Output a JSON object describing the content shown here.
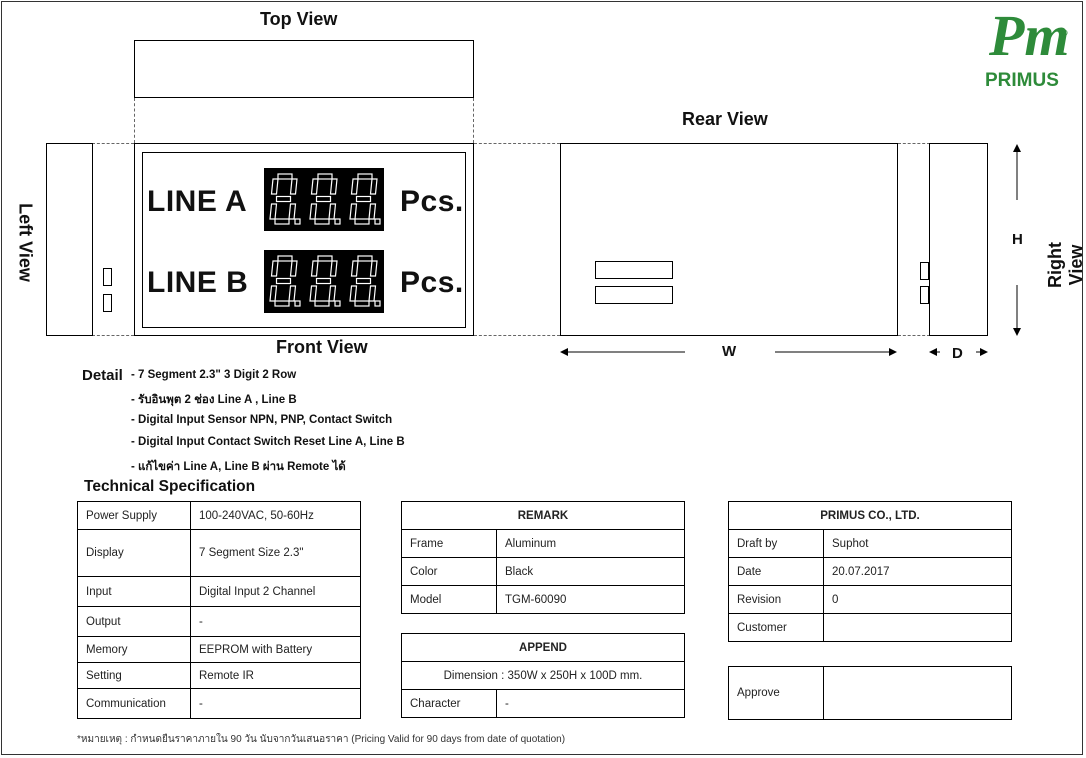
{
  "views": {
    "top": "Top View",
    "rear": "Rear View",
    "front": "Front View",
    "left": "Left View",
    "right": "Right View"
  },
  "front_panel": {
    "line_a": "LINE A",
    "line_b": "LINE B",
    "unit": "Pcs.",
    "digits_per_row": 3,
    "segment_color": "#ffffff"
  },
  "dimensions": {
    "w": "W",
    "h": "H",
    "d": "D"
  },
  "detail": {
    "title": "Detail",
    "items": [
      "- 7 Segment 2.3\"  3 Digit 2 Row",
      "- รับอินพุต 2 ช่อง Line A , Line B",
      "- Digital Input Sensor NPN, PNP, Contact Switch",
      "- Digital Input Contact Switch Reset Line A, Line B",
      "- แก้ไขค่า Line A, Line B ผ่าน Remote ได้"
    ]
  },
  "tech_spec": {
    "title": "Technical Specification",
    "rows": [
      {
        "label": "Power Supply",
        "value": "100-240VAC, 50-60Hz"
      },
      {
        "label": "Display",
        "value": "7 Segment Size 2.3\""
      },
      {
        "label": "Input",
        "value": "Digital Input 2 Channel"
      },
      {
        "label": "Output",
        "value": "-"
      },
      {
        "label": "Memory",
        "value": "EEPROM with Battery"
      },
      {
        "label": "Setting",
        "value": "Remote IR"
      },
      {
        "label": "Communication",
        "value": "-"
      }
    ]
  },
  "remark": {
    "title": "REMARK",
    "rows": [
      {
        "label": "Frame",
        "value": "Aluminum"
      },
      {
        "label": "Color",
        "value": "Black"
      },
      {
        "label": "Model",
        "value": "TGM-60090"
      }
    ]
  },
  "append": {
    "title": "APPEND",
    "dimension": "Dimension : 350W x 250H x 100D mm.",
    "character_label": "Character",
    "character_value": "-"
  },
  "company": {
    "title": "PRIMUS CO., LTD.",
    "rows": [
      {
        "label": "Draft by",
        "value": "Suphot"
      },
      {
        "label": "Date",
        "value": "20.07.2017"
      },
      {
        "label": "Revision",
        "value": "0"
      },
      {
        "label": "Customer",
        "value": ""
      }
    ],
    "approve": "Approve"
  },
  "logo": {
    "mark": "Pm",
    "registered": "®",
    "name": "PRIMUS",
    "color": "#2e8b3a"
  },
  "footnote": "*หมายเหตุ : กำหนดยืนราคาภายใน 90 วัน นับจากวันเสนอราคา  (Pricing Valid for 90 days from date of quotation)"
}
